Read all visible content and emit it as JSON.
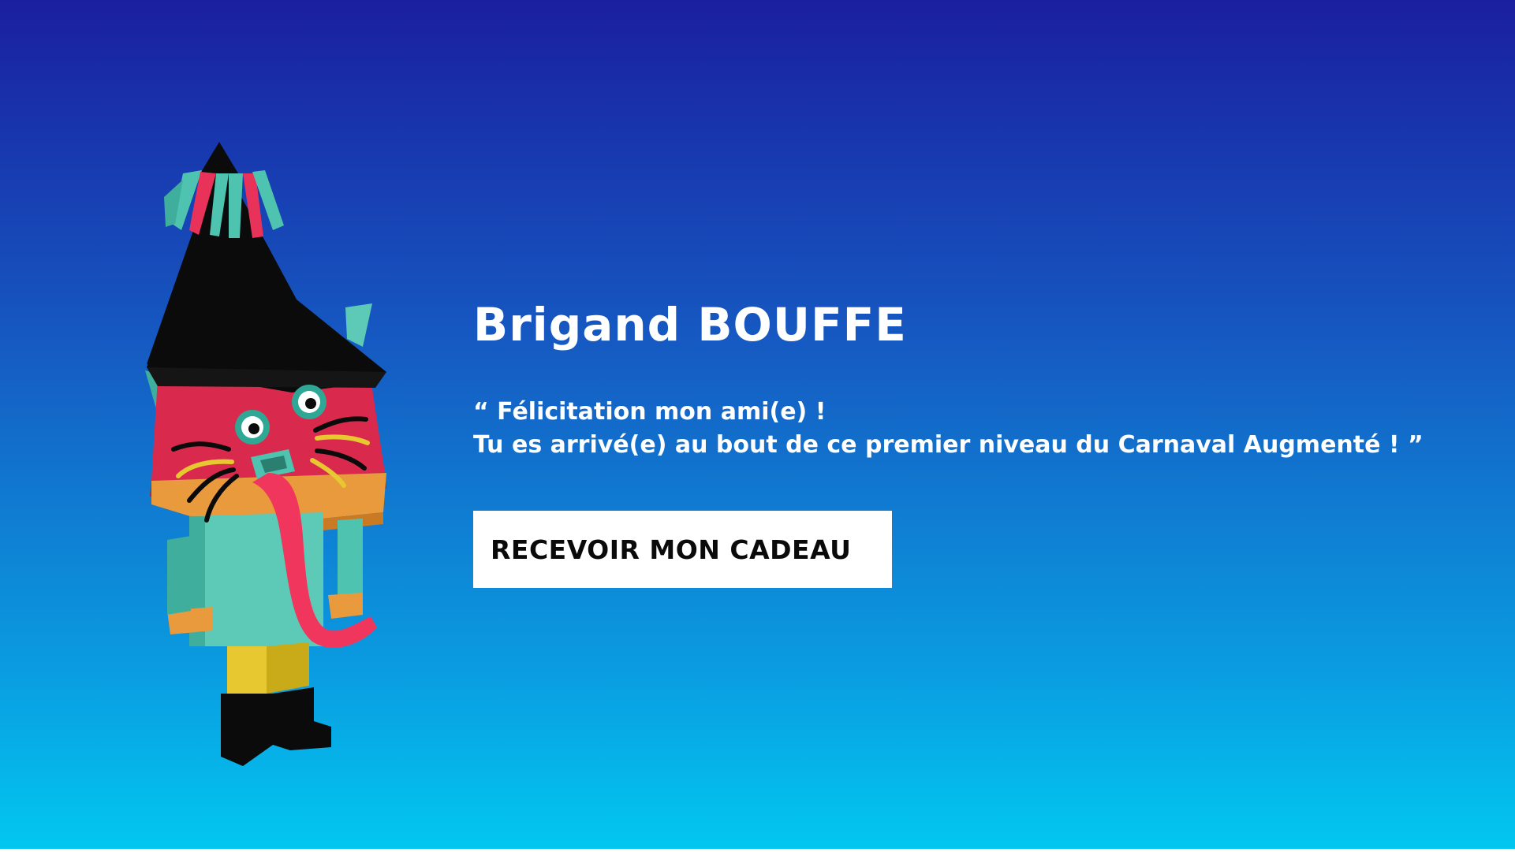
{
  "page": {
    "title": "Brigand BOUFFE",
    "message_line_1": "“ Félicitation mon ami(e) !",
    "message_line_2": "Tu es arrivé(e) au bout de ce premier niveau du Carnaval Augmenté ! ”",
    "button_label": "RECEVOIR MON CADEAU"
  },
  "character": {
    "icon": "carnival-brigand-character-illustration"
  },
  "colors": {
    "background_top": "#1a1fa0",
    "background_bottom": "#02c8f0",
    "text": "#ffffff",
    "button_bg": "#ffffff",
    "button_text": "#0a0a0a",
    "hat": "#0b0b0b",
    "fringe_teal": "#4ec3b0",
    "fringe_pink": "#e8325a",
    "face": "#d92a4e",
    "collar": "#e89a3c",
    "body": "#5ccab7",
    "legs": "#e8c830",
    "boots": "#0b0b0b",
    "tongue": "#f0365c"
  }
}
